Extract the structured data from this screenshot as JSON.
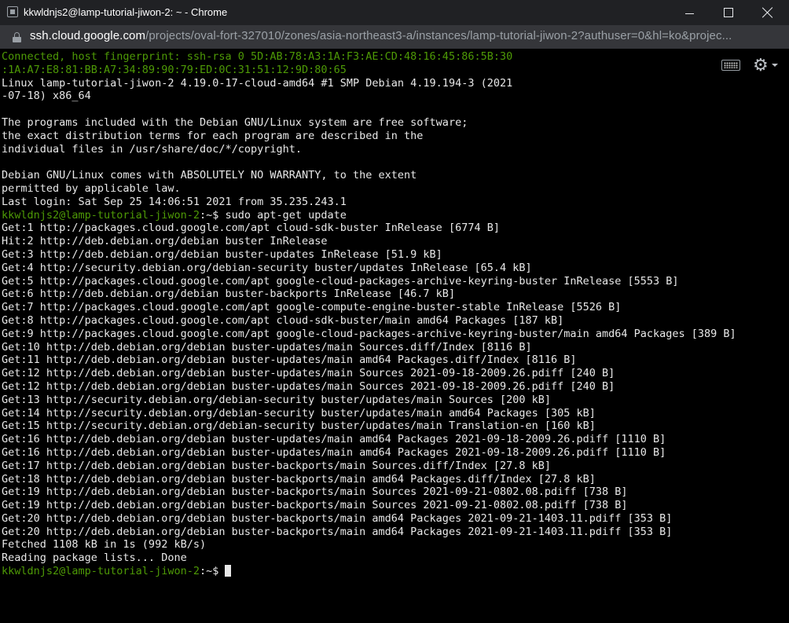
{
  "window": {
    "title": "kkwldnjs2@lamp-tutorial-jiwon-2: ~ - Chrome",
    "minimize_icon": "minimize-icon",
    "maximize_icon": "maximize-icon",
    "close_icon": "close-icon"
  },
  "address_bar": {
    "host": "ssh.cloud.google.com",
    "path": "/projects/oval-fort-327010/zones/asia-northeast3-a/instances/lamp-tutorial-jiwon-2?authuser=0&hl=ko&projec...",
    "icon": "lock-icon"
  },
  "toolbar": {
    "keyboard_icon": "keyboard-icon",
    "settings_icon": "gear-icon"
  },
  "colors": {
    "terminal_bg": "#000000",
    "terminal_fg": "#e8e8e8",
    "prompt_green": "#4e9a06",
    "titlebar_bg": "#202124",
    "addressbar_bg": "#35363a"
  },
  "terminal": {
    "lines": [
      {
        "prompt": "",
        "text": "Connected, host fingerprint: ssh-rsa 0 5D:AB:78:A3:1A:F3:AE:CD:48:16:45:86:5B:30",
        "green": true
      },
      {
        "prompt": "",
        "text": ":1A:A7:E8:81:BB:A7:34:89:90:79:ED:0C:31:51:12:9D:80:65",
        "green": true
      },
      {
        "prompt": "",
        "text": "Linux lamp-tutorial-jiwon-2 4.19.0-17-cloud-amd64 #1 SMP Debian 4.19.194-3 (2021"
      },
      {
        "prompt": "",
        "text": "-07-18) x86_64"
      },
      {
        "prompt": "",
        "text": ""
      },
      {
        "prompt": "",
        "text": "The programs included with the Debian GNU/Linux system are free software;"
      },
      {
        "prompt": "",
        "text": "the exact distribution terms for each program are described in the"
      },
      {
        "prompt": "",
        "text": "individual files in /usr/share/doc/*/copyright."
      },
      {
        "prompt": "",
        "text": ""
      },
      {
        "prompt": "",
        "text": "Debian GNU/Linux comes with ABSOLUTELY NO WARRANTY, to the extent"
      },
      {
        "prompt": "",
        "text": "permitted by applicable law."
      },
      {
        "prompt": "",
        "text": "Last login: Sat Sep 25 14:06:51 2021 from 35.235.243.1"
      },
      {
        "prompt": "kkwldnjs2@lamp-tutorial-jiwon-2",
        "text": ":~$ sudo apt-get update"
      },
      {
        "prompt": "",
        "text": "Get:1 http://packages.cloud.google.com/apt cloud-sdk-buster InRelease [6774 B]"
      },
      {
        "prompt": "",
        "text": "Hit:2 http://deb.debian.org/debian buster InRelease"
      },
      {
        "prompt": "",
        "text": "Get:3 http://deb.debian.org/debian buster-updates InRelease [51.9 kB]"
      },
      {
        "prompt": "",
        "text": "Get:4 http://security.debian.org/debian-security buster/updates InRelease [65.4 kB]"
      },
      {
        "prompt": "",
        "text": "Get:5 http://packages.cloud.google.com/apt google-cloud-packages-archive-keyring-buster InRelease [5553 B]"
      },
      {
        "prompt": "",
        "text": "Get:6 http://deb.debian.org/debian buster-backports InRelease [46.7 kB]"
      },
      {
        "prompt": "",
        "text": "Get:7 http://packages.cloud.google.com/apt google-compute-engine-buster-stable InRelease [5526 B]"
      },
      {
        "prompt": "",
        "text": "Get:8 http://packages.cloud.google.com/apt cloud-sdk-buster/main amd64 Packages [187 kB]"
      },
      {
        "prompt": "",
        "text": "Get:9 http://packages.cloud.google.com/apt google-cloud-packages-archive-keyring-buster/main amd64 Packages [389 B]"
      },
      {
        "prompt": "",
        "text": "Get:10 http://deb.debian.org/debian buster-updates/main Sources.diff/Index [8116 B]"
      },
      {
        "prompt": "",
        "text": "Get:11 http://deb.debian.org/debian buster-updates/main amd64 Packages.diff/Index [8116 B]"
      },
      {
        "prompt": "",
        "text": "Get:12 http://deb.debian.org/debian buster-updates/main Sources 2021-09-18-2009.26.pdiff [240 B]"
      },
      {
        "prompt": "",
        "text": "Get:12 http://deb.debian.org/debian buster-updates/main Sources 2021-09-18-2009.26.pdiff [240 B]"
      },
      {
        "prompt": "",
        "text": "Get:13 http://security.debian.org/debian-security buster/updates/main Sources [200 kB]"
      },
      {
        "prompt": "",
        "text": "Get:14 http://security.debian.org/debian-security buster/updates/main amd64 Packages [305 kB]"
      },
      {
        "prompt": "",
        "text": "Get:15 http://security.debian.org/debian-security buster/updates/main Translation-en [160 kB]"
      },
      {
        "prompt": "",
        "text": "Get:16 http://deb.debian.org/debian buster-updates/main amd64 Packages 2021-09-18-2009.26.pdiff [1110 B]"
      },
      {
        "prompt": "",
        "text": "Get:16 http://deb.debian.org/debian buster-updates/main amd64 Packages 2021-09-18-2009.26.pdiff [1110 B]"
      },
      {
        "prompt": "",
        "text": "Get:17 http://deb.debian.org/debian buster-backports/main Sources.diff/Index [27.8 kB]"
      },
      {
        "prompt": "",
        "text": "Get:18 http://deb.debian.org/debian buster-backports/main amd64 Packages.diff/Index [27.8 kB]"
      },
      {
        "prompt": "",
        "text": "Get:19 http://deb.debian.org/debian buster-backports/main Sources 2021-09-21-0802.08.pdiff [738 B]"
      },
      {
        "prompt": "",
        "text": "Get:19 http://deb.debian.org/debian buster-backports/main Sources 2021-09-21-0802.08.pdiff [738 B]"
      },
      {
        "prompt": "",
        "text": "Get:20 http://deb.debian.org/debian buster-backports/main amd64 Packages 2021-09-21-1403.11.pdiff [353 B]"
      },
      {
        "prompt": "",
        "text": "Get:20 http://deb.debian.org/debian buster-backports/main amd64 Packages 2021-09-21-1403.11.pdiff [353 B]"
      },
      {
        "prompt": "",
        "text": "Fetched 1108 kB in 1s (992 kB/s)"
      },
      {
        "prompt": "",
        "text": "Reading package lists... Done"
      },
      {
        "prompt": "kkwldnjs2@lamp-tutorial-jiwon-2",
        "text": ":~$ ",
        "cursor": true
      }
    ]
  }
}
